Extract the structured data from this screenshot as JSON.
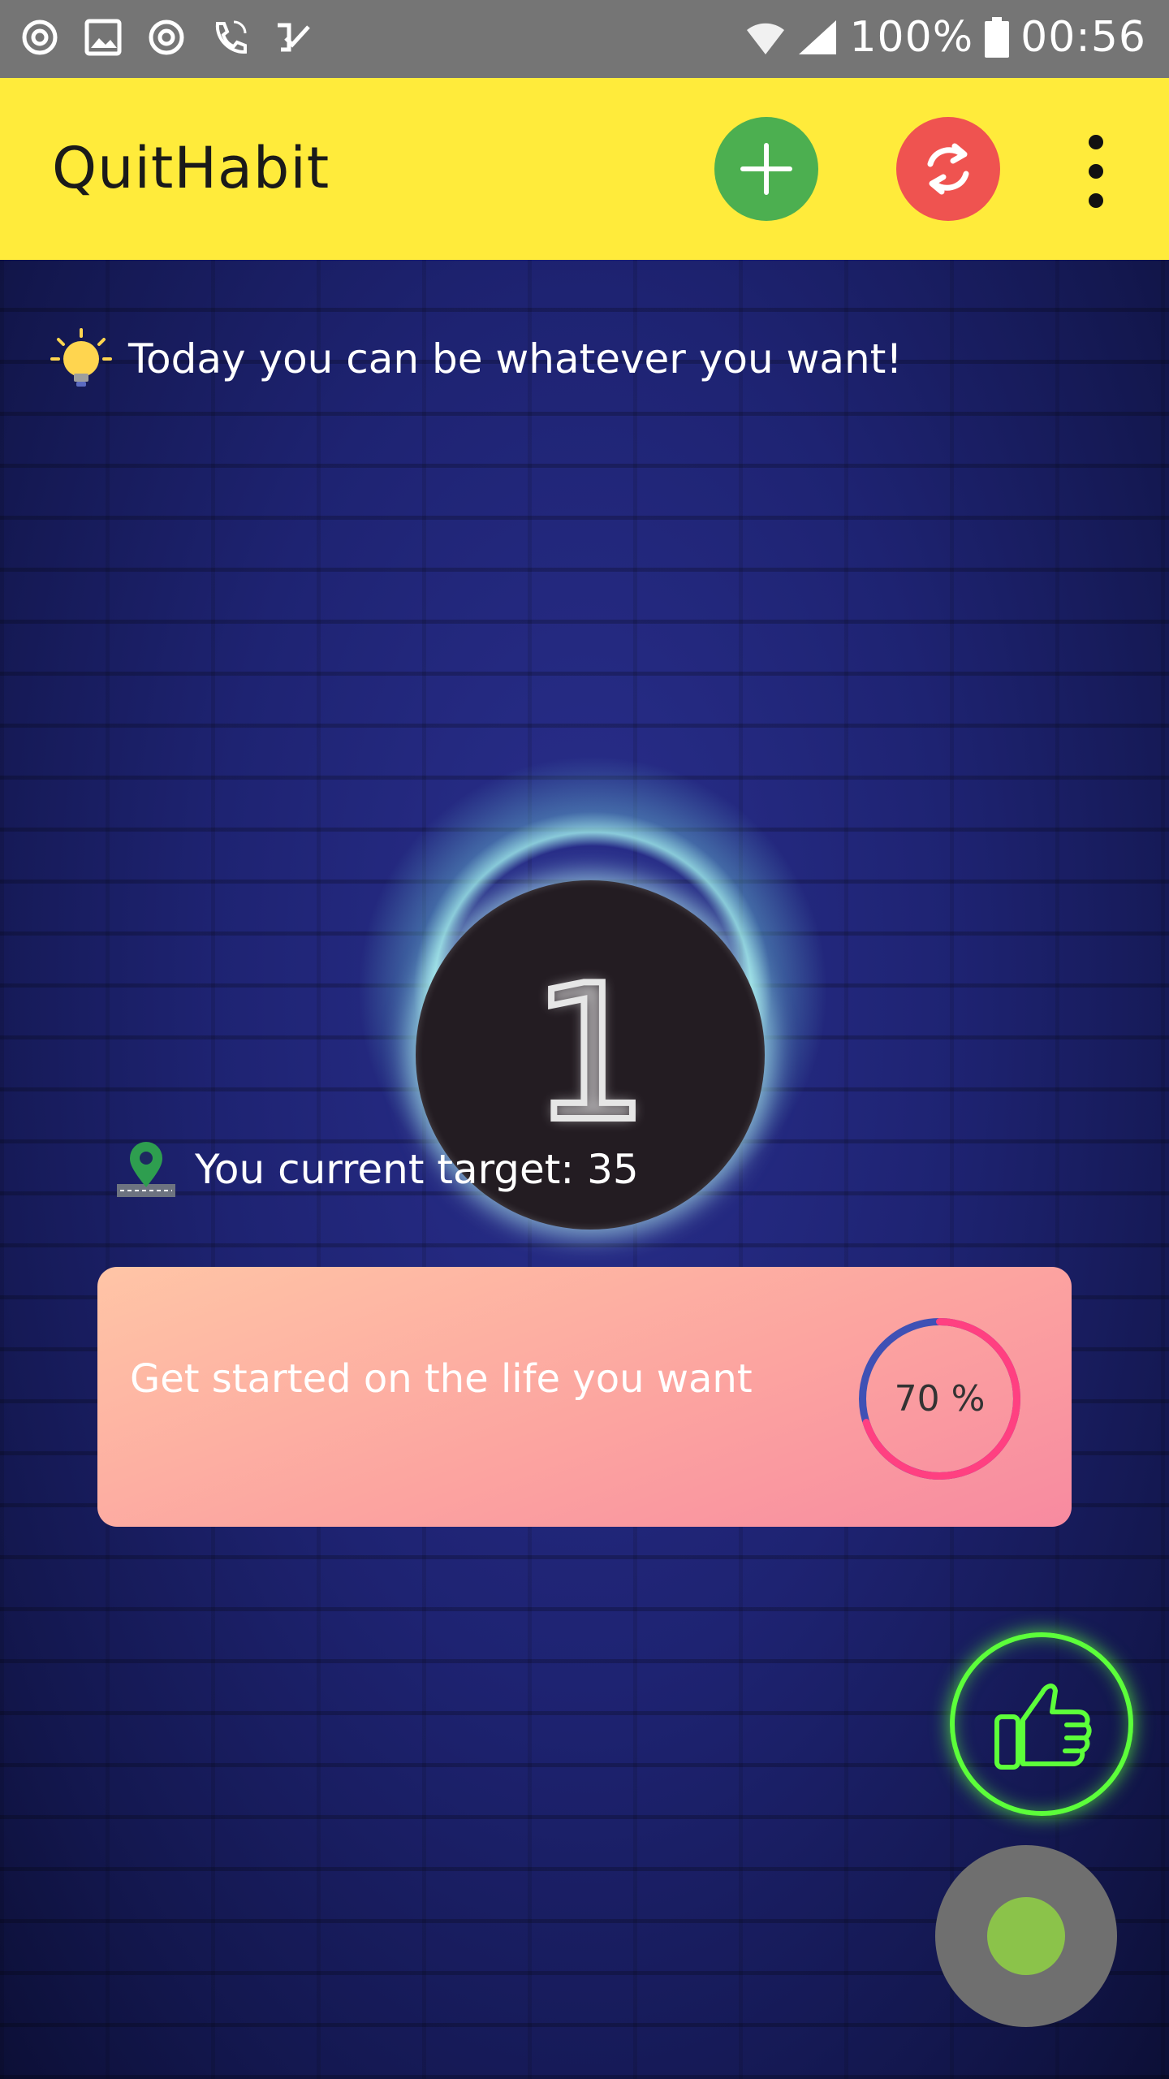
{
  "status_bar": {
    "battery": "100%",
    "time": "00:56",
    "left_icons": [
      "sync-icon",
      "image-icon",
      "sync-alt-icon",
      "wifi-call-icon",
      "task-check-icon"
    ],
    "right_icons": [
      "wifi-icon",
      "signal-icon",
      "battery-icon"
    ]
  },
  "app_bar": {
    "title": "QuitHabit",
    "add_color": "#4CAF50",
    "sync_color": "#EF5350",
    "background": "#FFEB3B"
  },
  "main": {
    "tip": "Today you can be whatever you want!",
    "counter": "1",
    "target_text": "You current target: 35",
    "card": {
      "text": "Get started on the life you want",
      "progress_label": "70 %",
      "progress_value": 0.7
    }
  }
}
